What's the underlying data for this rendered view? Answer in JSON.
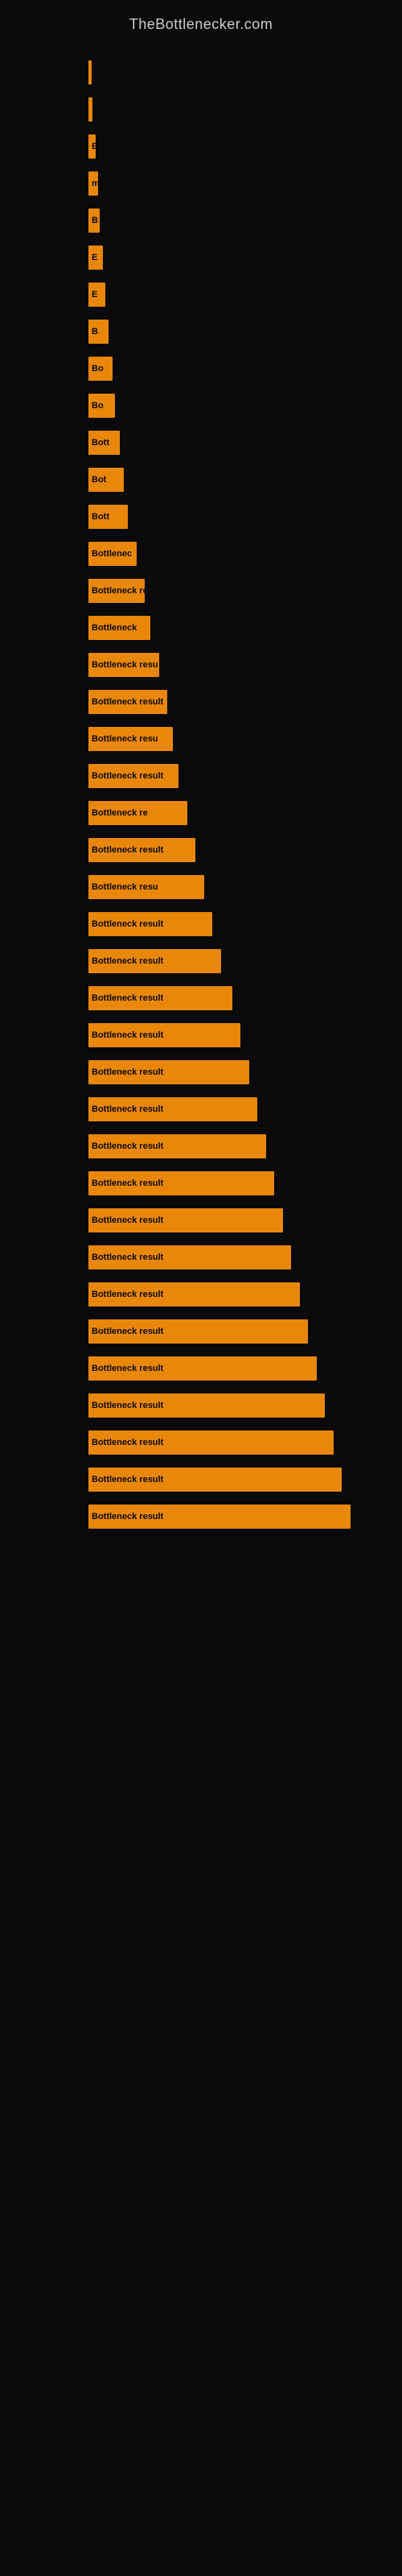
{
  "site": {
    "title": "TheBottlenecker.com"
  },
  "bars": [
    {
      "id": 1,
      "label": "",
      "width_pct": 0.5,
      "text": ""
    },
    {
      "id": 2,
      "label": "",
      "width_pct": 1.5,
      "text": ""
    },
    {
      "id": 3,
      "label": "",
      "width_pct": 2.5,
      "text": "E"
    },
    {
      "id": 4,
      "label": "",
      "width_pct": 3.5,
      "text": "m"
    },
    {
      "id": 5,
      "label": "",
      "width_pct": 4.0,
      "text": "B"
    },
    {
      "id": 6,
      "label": "",
      "width_pct": 5.0,
      "text": "E"
    },
    {
      "id": 7,
      "label": "",
      "width_pct": 6.0,
      "text": "E"
    },
    {
      "id": 8,
      "label": "",
      "width_pct": 7.0,
      "text": "B"
    },
    {
      "id": 9,
      "label": "",
      "width_pct": 8.5,
      "text": "Bo"
    },
    {
      "id": 10,
      "label": "",
      "width_pct": 9.5,
      "text": "Bo"
    },
    {
      "id": 11,
      "label": "",
      "width_pct": 11.0,
      "text": "Bott"
    },
    {
      "id": 12,
      "label": "",
      "width_pct": 12.5,
      "text": "Bot"
    },
    {
      "id": 13,
      "label": "",
      "width_pct": 14.0,
      "text": "Bott"
    },
    {
      "id": 14,
      "label": "",
      "width_pct": 17.0,
      "text": "Bottlenec"
    },
    {
      "id": 15,
      "label": "",
      "width_pct": 20.0,
      "text": "Bottleneck re"
    },
    {
      "id": 16,
      "label": "",
      "width_pct": 22.0,
      "text": "Bottleneck"
    },
    {
      "id": 17,
      "label": "",
      "width_pct": 25.0,
      "text": "Bottleneck resu"
    },
    {
      "id": 18,
      "label": "",
      "width_pct": 28.0,
      "text": "Bottleneck result"
    },
    {
      "id": 19,
      "label": "",
      "width_pct": 30.0,
      "text": "Bottleneck resu"
    },
    {
      "id": 20,
      "label": "",
      "width_pct": 32.0,
      "text": "Bottleneck result"
    },
    {
      "id": 21,
      "label": "",
      "width_pct": 35.0,
      "text": "Bottleneck re"
    },
    {
      "id": 22,
      "label": "",
      "width_pct": 38.0,
      "text": "Bottleneck result"
    },
    {
      "id": 23,
      "label": "",
      "width_pct": 41.0,
      "text": "Bottleneck resu"
    },
    {
      "id": 24,
      "label": "",
      "width_pct": 44.0,
      "text": "Bottleneck result"
    },
    {
      "id": 25,
      "label": "",
      "width_pct": 47.0,
      "text": "Bottleneck result"
    },
    {
      "id": 26,
      "label": "",
      "width_pct": 51.0,
      "text": "Bottleneck result"
    },
    {
      "id": 27,
      "label": "",
      "width_pct": 54.0,
      "text": "Bottleneck result"
    },
    {
      "id": 28,
      "label": "",
      "width_pct": 57.0,
      "text": "Bottleneck result"
    },
    {
      "id": 29,
      "label": "",
      "width_pct": 60.0,
      "text": "Bottleneck result"
    },
    {
      "id": 30,
      "label": "",
      "width_pct": 63.0,
      "text": "Bottleneck result"
    },
    {
      "id": 31,
      "label": "",
      "width_pct": 66.0,
      "text": "Bottleneck result"
    },
    {
      "id": 32,
      "label": "",
      "width_pct": 69.0,
      "text": "Bottleneck result"
    },
    {
      "id": 33,
      "label": "",
      "width_pct": 72.0,
      "text": "Bottleneck result"
    },
    {
      "id": 34,
      "label": "",
      "width_pct": 75.0,
      "text": "Bottleneck result"
    },
    {
      "id": 35,
      "label": "",
      "width_pct": 78.0,
      "text": "Bottleneck result"
    },
    {
      "id": 36,
      "label": "",
      "width_pct": 81.0,
      "text": "Bottleneck result"
    },
    {
      "id": 37,
      "label": "",
      "width_pct": 84.0,
      "text": "Bottleneck result"
    },
    {
      "id": 38,
      "label": "",
      "width_pct": 87.0,
      "text": "Bottleneck result"
    },
    {
      "id": 39,
      "label": "",
      "width_pct": 90.0,
      "text": "Bottleneck result"
    },
    {
      "id": 40,
      "label": "",
      "width_pct": 93.0,
      "text": "Bottleneck result"
    }
  ]
}
